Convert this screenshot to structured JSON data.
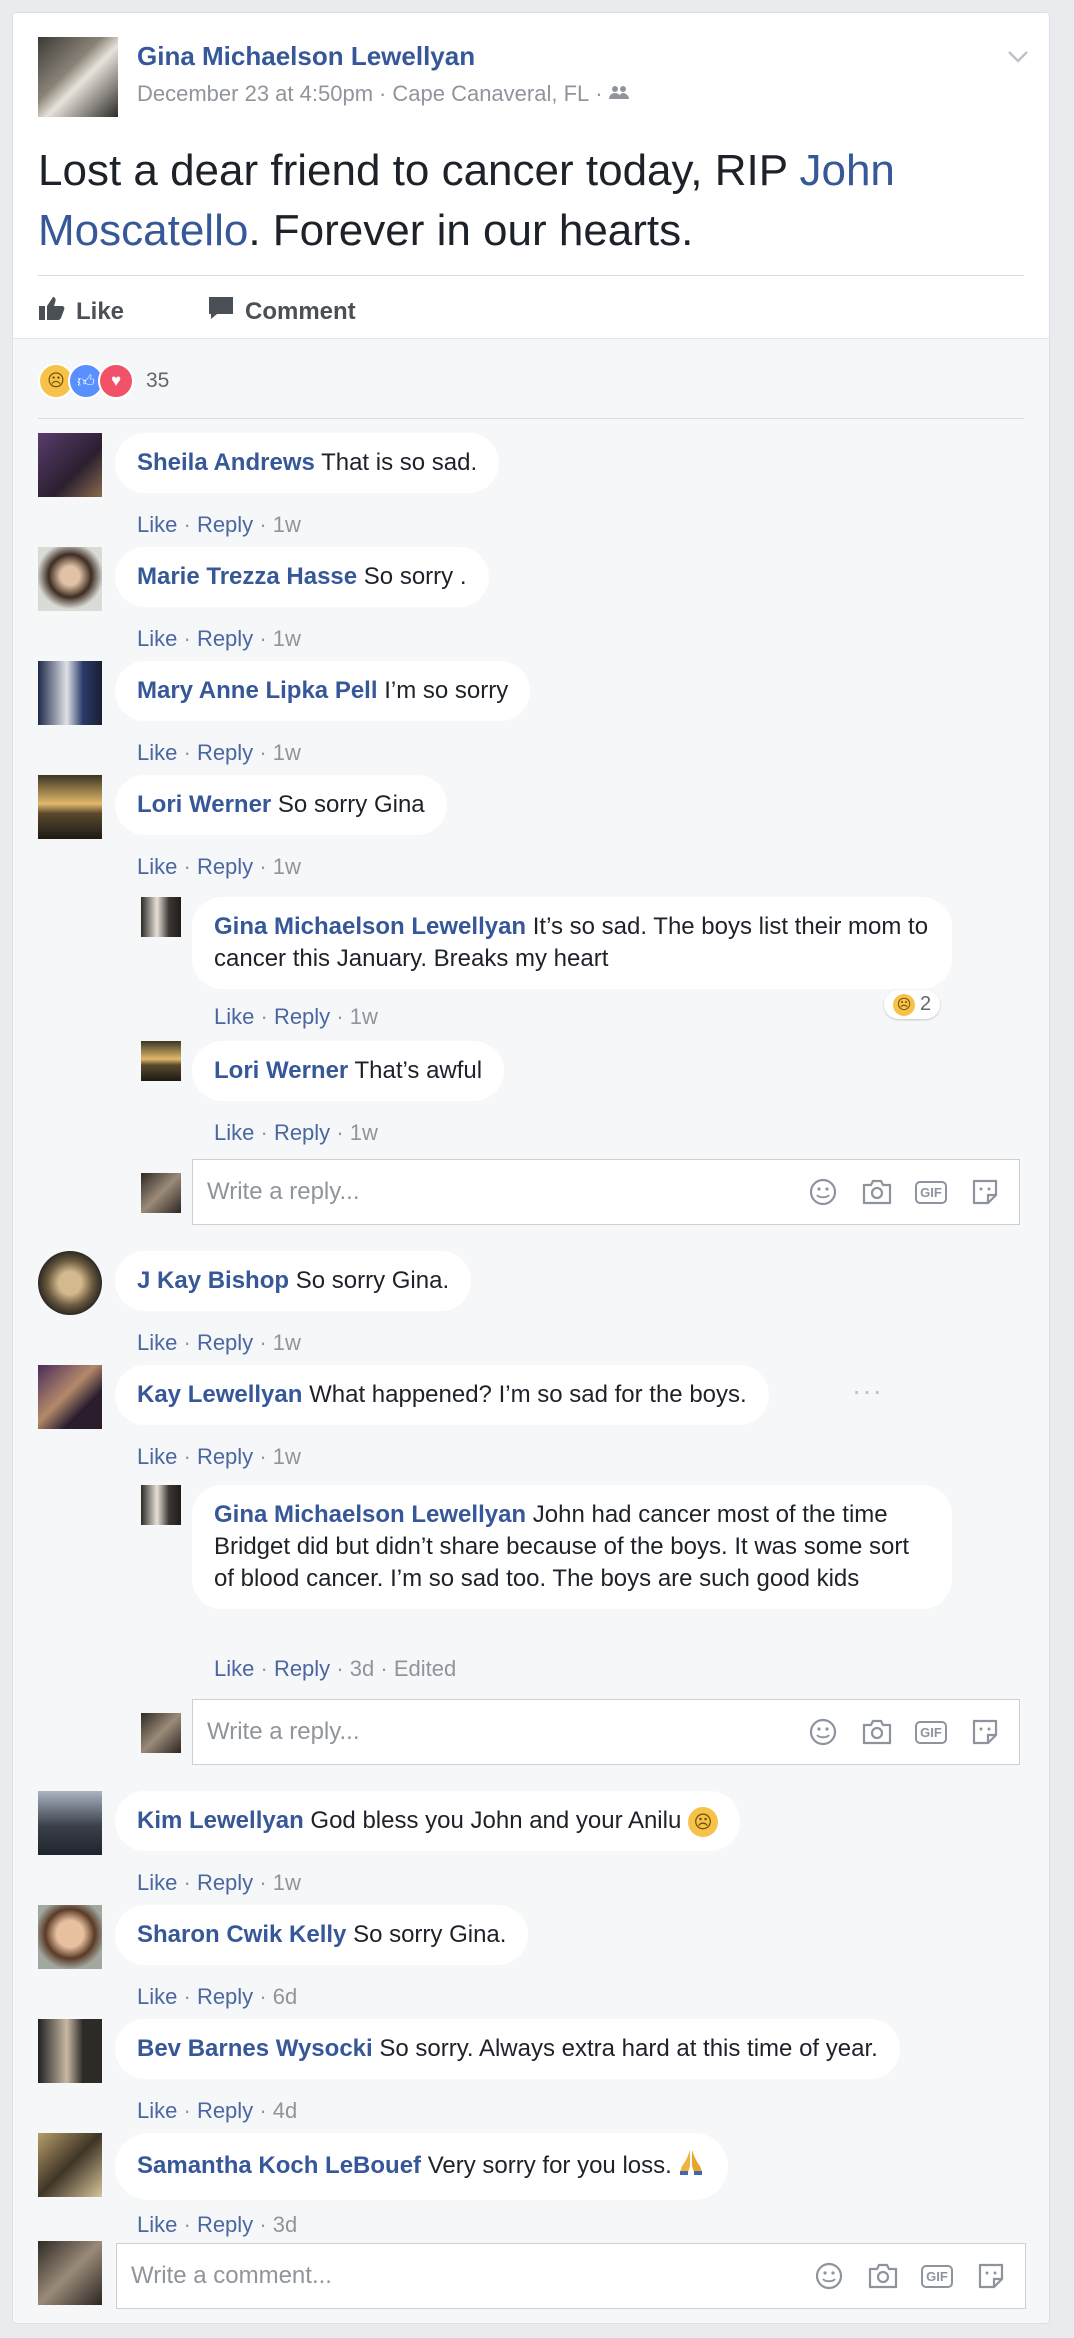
{
  "post": {
    "author": "Gina Michaelson Lewellyan",
    "date": "December 23 at 4:50pm",
    "location": "Cape Canaveral, FL",
    "text_before": "Lost a dear friend to cancer today, RIP ",
    "tagged": "John Moscatello",
    "text_after": ". Forever in our hearts.",
    "like_label": "Like",
    "comment_label": "Comment",
    "reaction_count": "35"
  },
  "comments": [
    {
      "name": "Sheila Andrews",
      "text": "That is so sad.",
      "like": "Like",
      "reply": "Reply",
      "time": "1w"
    },
    {
      "name": "Marie Trezza Hasse",
      "text": "So sorry .",
      "like": "Like",
      "reply": "Reply",
      "time": "1w"
    },
    {
      "name": "Mary Anne Lipka Pell",
      "text": "I’m so sorry",
      "like": "Like",
      "reply": "Reply",
      "time": "1w"
    },
    {
      "name": "Lori Werner",
      "text": "So sorry Gina",
      "like": "Like",
      "reply": "Reply",
      "time": "1w"
    },
    {
      "name": "Gina Michaelson Lewellyan",
      "text": "It’s so sad. The boys list their mom to cancer this January. Breaks my heart",
      "like": "Like",
      "reply": "Reply",
      "time": "1w",
      "reaction_count": "2"
    },
    {
      "name": "Lori Werner",
      "text": "That’s awful",
      "like": "Like",
      "reply": "Reply",
      "time": "1w"
    },
    {
      "name": "J Kay Bishop",
      "text": "So sorry Gina.",
      "like": "Like",
      "reply": "Reply",
      "time": "1w"
    },
    {
      "name": "Kay Lewellyan",
      "text": "What happened? I’m so sad for the boys.",
      "like": "Like",
      "reply": "Reply",
      "time": "1w"
    },
    {
      "name": "Gina Michaelson Lewellyan",
      "text": "John had cancer most of the time Bridget did but didn’t share because of the boys. It was some sort of blood cancer. I’m so sad too. The boys are such good kids",
      "like": "Like",
      "reply": "Reply",
      "time": "3d",
      "edited": "Edited"
    },
    {
      "name": "Kim Lewellyan",
      "text": "God bless you John and your Anilu",
      "like": "Like",
      "reply": "Reply",
      "time": "1w"
    },
    {
      "name": "Sharon Cwik Kelly",
      "text": "So sorry Gina.",
      "like": "Like",
      "reply": "Reply",
      "time": "6d"
    },
    {
      "name": "Bev Barnes Wysocki",
      "text": "So sorry. Always extra hard at this time of year.",
      "like": "Like",
      "reply": "Reply",
      "time": "4d"
    },
    {
      "name": "Samantha Koch LeBouef",
      "text": "Very sorry for you loss.",
      "like": "Like",
      "reply": "Reply",
      "time": "3d"
    }
  ],
  "reply_placeholder": "Write a reply...",
  "comment_placeholder": "Write a comment...",
  "gif_label": "GIF",
  "sep": "·",
  "colors": {
    "link": "#365899",
    "meta": "#90949c",
    "background": "#f6f7f9"
  },
  "icons": [
    "friends-icon",
    "chevron-down-icon",
    "like-icon",
    "comment-icon",
    "sad-reaction-icon",
    "like-reaction-icon",
    "love-reaction-icon",
    "emoji-icon",
    "camera-icon",
    "gif-icon",
    "sticker-icon",
    "crying-emoji-icon",
    "praying-hands-icon"
  ]
}
